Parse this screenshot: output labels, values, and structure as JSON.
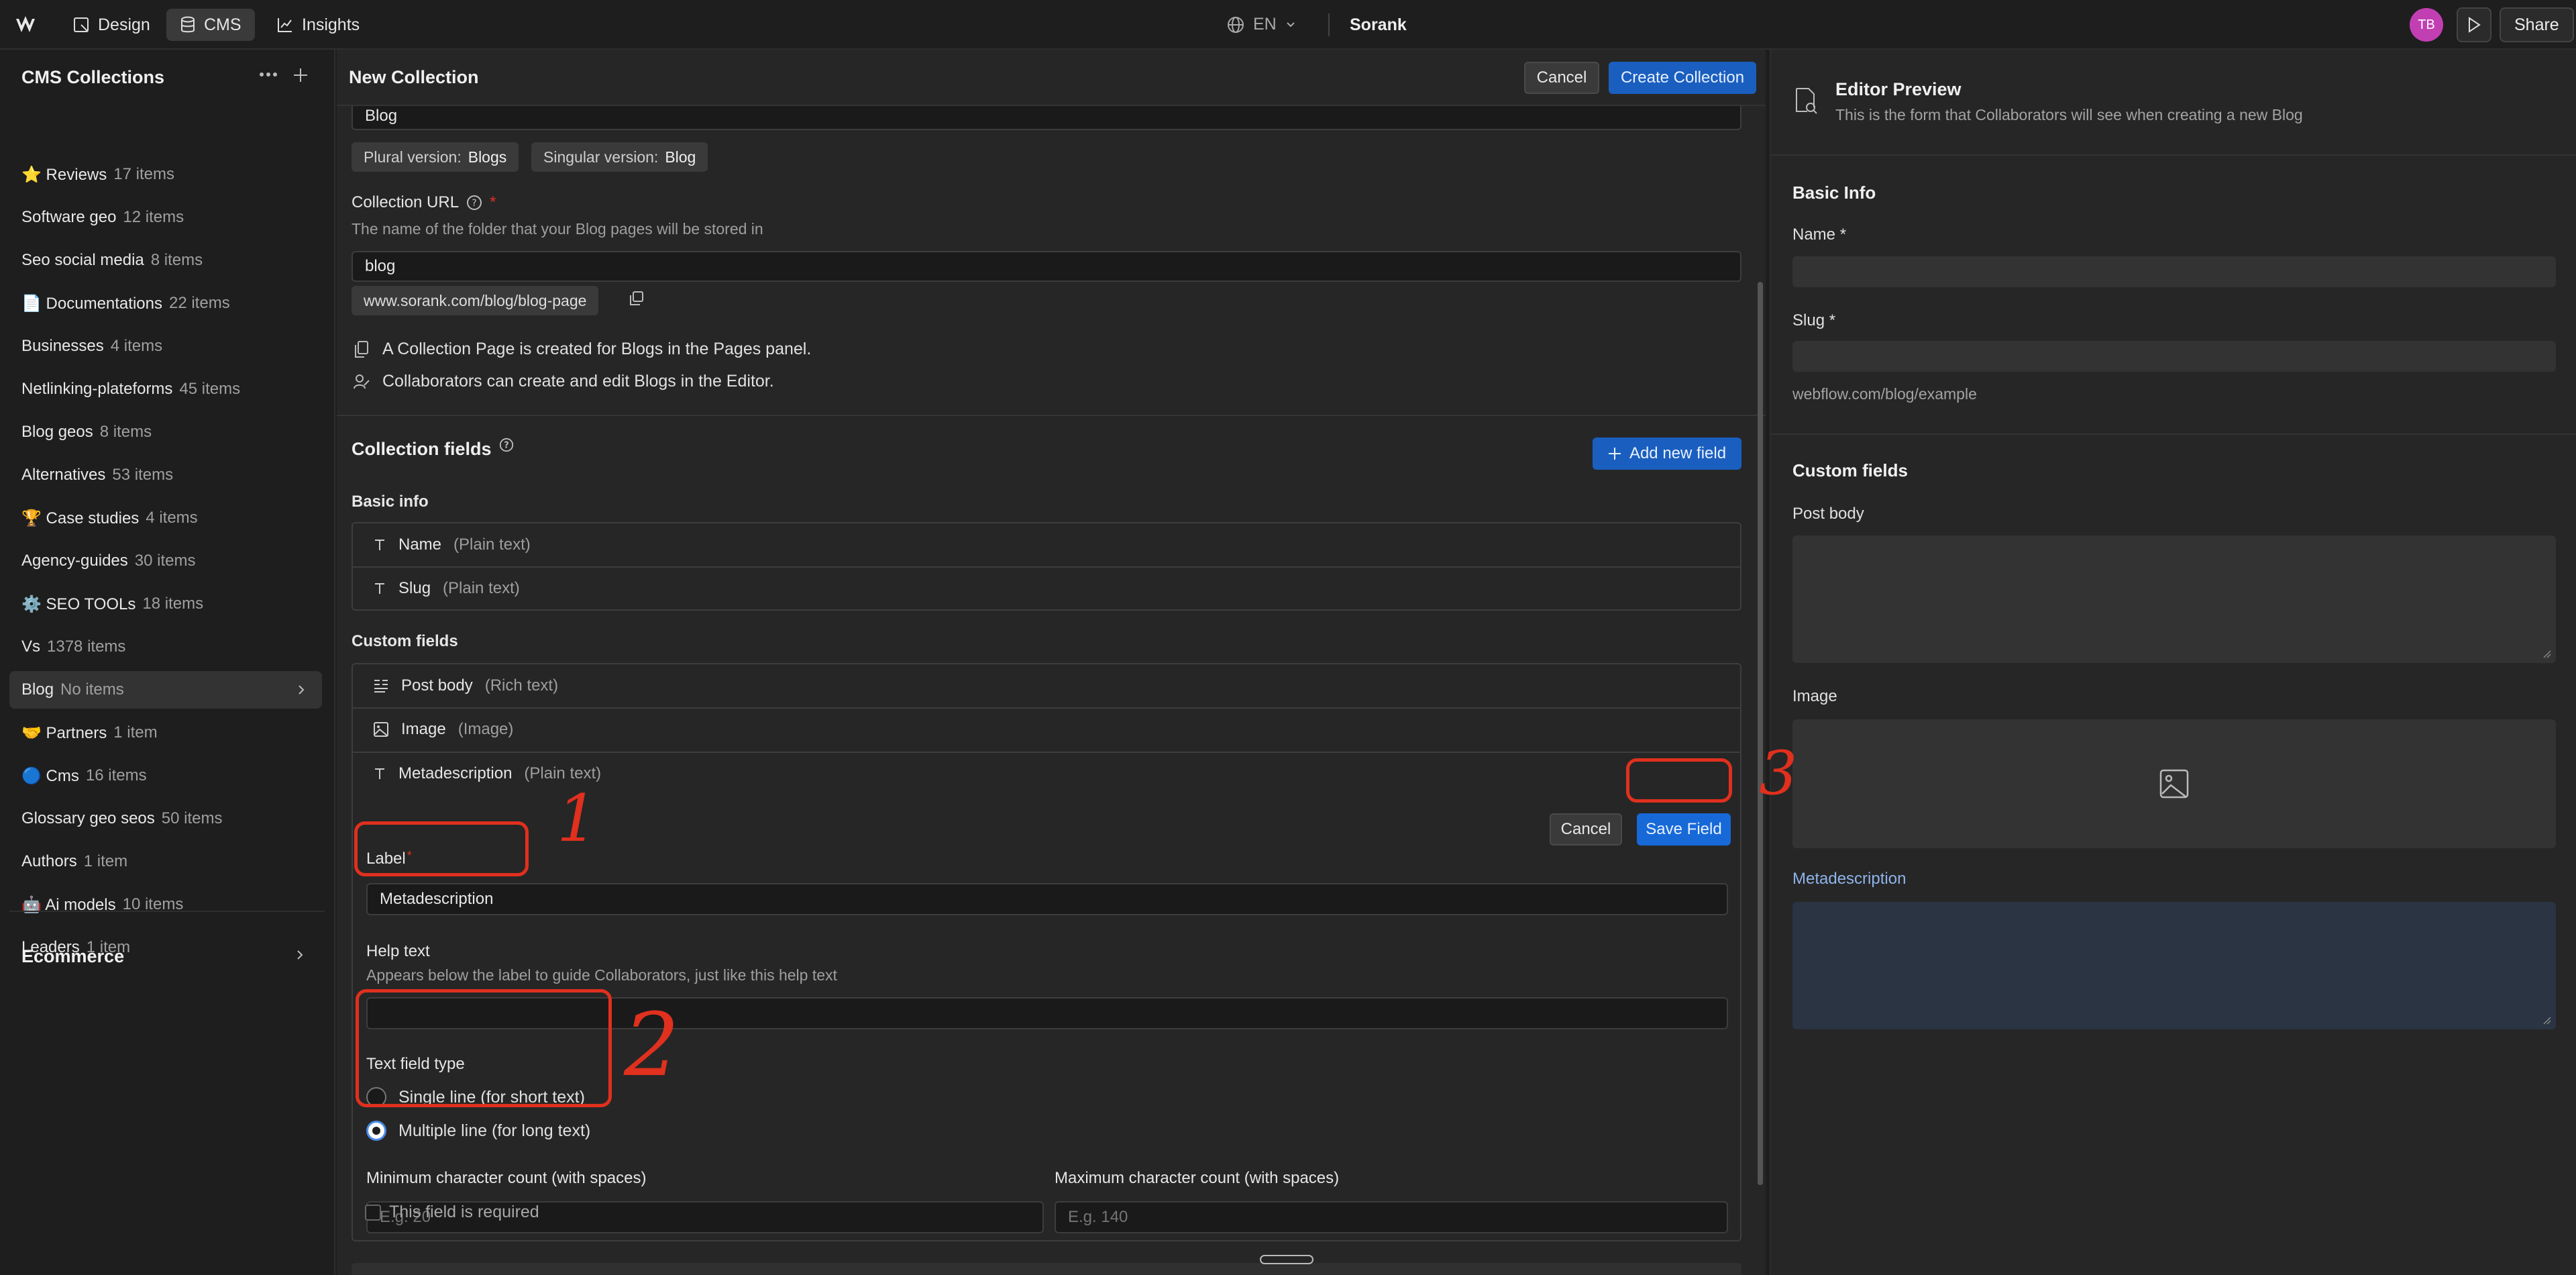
{
  "topbar": {
    "tabs": [
      {
        "label": "Design",
        "icon": "design-icon"
      },
      {
        "label": "CMS",
        "icon": "database-icon",
        "active": true
      },
      {
        "label": "Insights",
        "icon": "chart-icon"
      }
    ],
    "language": "EN",
    "site_name": "Sorank",
    "avatar_initials": "TB",
    "share_label": "Share"
  },
  "sidebar": {
    "title": "CMS Collections",
    "items": [
      {
        "name": "⭐ Reviews",
        "count": "17 items"
      },
      {
        "name": "Software geo",
        "count": "12 items"
      },
      {
        "name": "Seo social media",
        "count": "8 items"
      },
      {
        "name": "📄 Documentations",
        "count": "22 items"
      },
      {
        "name": "Businesses",
        "count": "4 items"
      },
      {
        "name": "Netlinking-plateforms",
        "count": "45 items"
      },
      {
        "name": "Blog geos",
        "count": "8 items"
      },
      {
        "name": "Alternatives",
        "count": "53 items"
      },
      {
        "name": "🏆 Case studies",
        "count": "4 items"
      },
      {
        "name": "Agency-guides",
        "count": "30 items"
      },
      {
        "name": "⚙️ SEO TOOLs",
        "count": "18 items"
      },
      {
        "name": "Vs",
        "count": "1378 items"
      },
      {
        "name": "Blog",
        "count": "No items",
        "selected": true
      },
      {
        "name": "🤝 Partners",
        "count": "1 item"
      },
      {
        "name": "🔵 Cms",
        "count": "16 items"
      },
      {
        "name": "Glossary geo seos",
        "count": "50 items"
      },
      {
        "name": "Authors",
        "count": "1 item"
      },
      {
        "name": "🤖 Ai models",
        "count": "10 items"
      },
      {
        "name": "Leaders",
        "count": "1 item"
      }
    ],
    "ecommerce_label": "Ecommerce"
  },
  "editor": {
    "title": "New Collection",
    "cancel_label": "Cancel",
    "create_label": "Create Collection",
    "collection_name_value": "Blog",
    "plural_label": "Plural version:",
    "plural_value": "Blogs",
    "singular_label": "Singular version:",
    "singular_value": "Blog",
    "url_label": "Collection URL",
    "url_help": "The name of the folder that your Blog pages will be stored in",
    "url_value": "blog",
    "url_preview": "www.sorank.com/blog/blog-page",
    "info_page": "A Collection Page is created for Blogs in the Pages panel.",
    "info_collab": "Collaborators can create and edit Blogs in the Editor.",
    "fields_title": "Collection fields",
    "add_field_label": "Add new field",
    "basic_info_label": "Basic info",
    "basic_fields": [
      {
        "name": "Name",
        "type": "(Plain text)"
      },
      {
        "name": "Slug",
        "type": "(Plain text)"
      }
    ],
    "custom_fields_label": "Custom fields",
    "custom_fields": [
      {
        "name": "Post body",
        "type": "(Rich text)"
      },
      {
        "name": "Image",
        "type": "(Image)"
      }
    ],
    "editing_field": {
      "name": "Metadescription",
      "type": "(Plain text)",
      "cancel_label": "Cancel",
      "save_label": "Save Field",
      "label_title": "Label",
      "label_value": "Metadescription",
      "help_title": "Help text",
      "help_sub": "Appears below the label to guide Collaborators, just like this help text",
      "help_value": "",
      "type_title": "Text field type",
      "options": [
        "Single line (for short text)",
        "Multiple line (for long text)"
      ],
      "selected_option": 1,
      "min_label": "Minimum character count (with spaces)",
      "min_placeholder": "E.g. 20",
      "max_label": "Maximum character count (with spaces)",
      "max_placeholder": "E.g. 140",
      "required_label": "This field is required"
    }
  },
  "annotations": {
    "one": "1",
    "two": "2",
    "three": "3"
  },
  "preview": {
    "title": "Editor Preview",
    "subtitle": "This is the form that Collaborators will see when creating a new Blog",
    "basic_info": "Basic Info",
    "name_label": "Name *",
    "slug_label": "Slug *",
    "slug_example": "webflow.com/blog/example",
    "custom_fields": "Custom fields",
    "post_body_label": "Post body",
    "image_label": "Image",
    "meta_label": "Metadescription"
  },
  "colors": {
    "accent": "#1a5fbf",
    "annotation": "#e0301e",
    "highlight_label": "#8fb4ea"
  }
}
